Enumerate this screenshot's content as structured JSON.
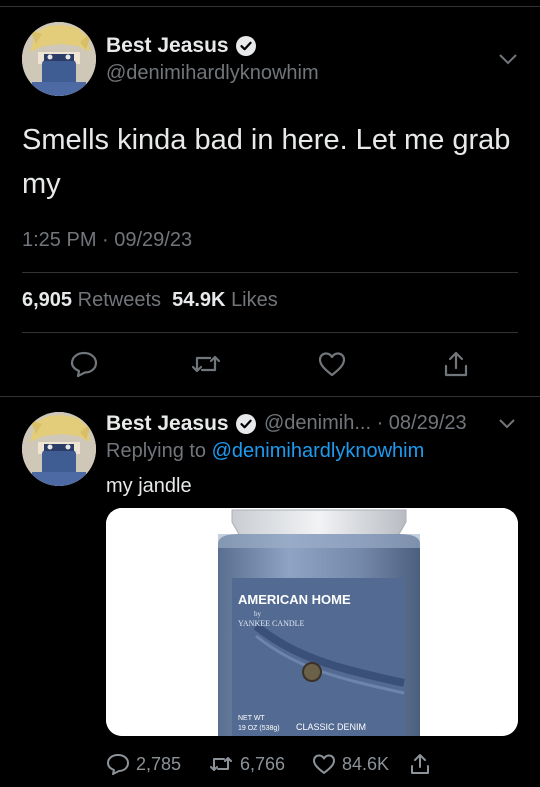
{
  "main_tweet": {
    "display_name": "Best Jeasus",
    "handle": "@denimihardlyknowhim",
    "text": "Smells kinda bad in here. Let me grab my",
    "timestamp": "1:25 PM · 09/29/23",
    "retweets_count": "6,905",
    "retweets_label": "Retweets",
    "likes_count": "54.9K",
    "likes_label": "Likes"
  },
  "reply_tweet": {
    "display_name": "Best Jeasus",
    "handle_date": "@denimih... · 08/29/23",
    "replying_prefix": "Replying to",
    "replying_handle": "@denimihardlyknowhim",
    "text": "my jandle",
    "media": {
      "label_brand": "AMERICAN HOME",
      "label_by": "by",
      "label_maker": "YANKEE CANDLE",
      "label_scent": "CLASSIC DENIM",
      "label_net": "NET WT",
      "label_weight": "19 OZ (538g)"
    },
    "replies": "2,785",
    "retweets": "6,766",
    "likes": "84.6K"
  },
  "icons": {
    "verified": "verified-badge-icon",
    "chevron": "chevron-down-icon",
    "reply": "reply-icon",
    "retweet": "retweet-icon",
    "like": "heart-icon",
    "share": "share-icon"
  },
  "colors": {
    "background": "#000000",
    "text": "#e7e9ea",
    "muted": "#71767b",
    "link": "#1d9bf0",
    "divider": "#2f3336"
  }
}
